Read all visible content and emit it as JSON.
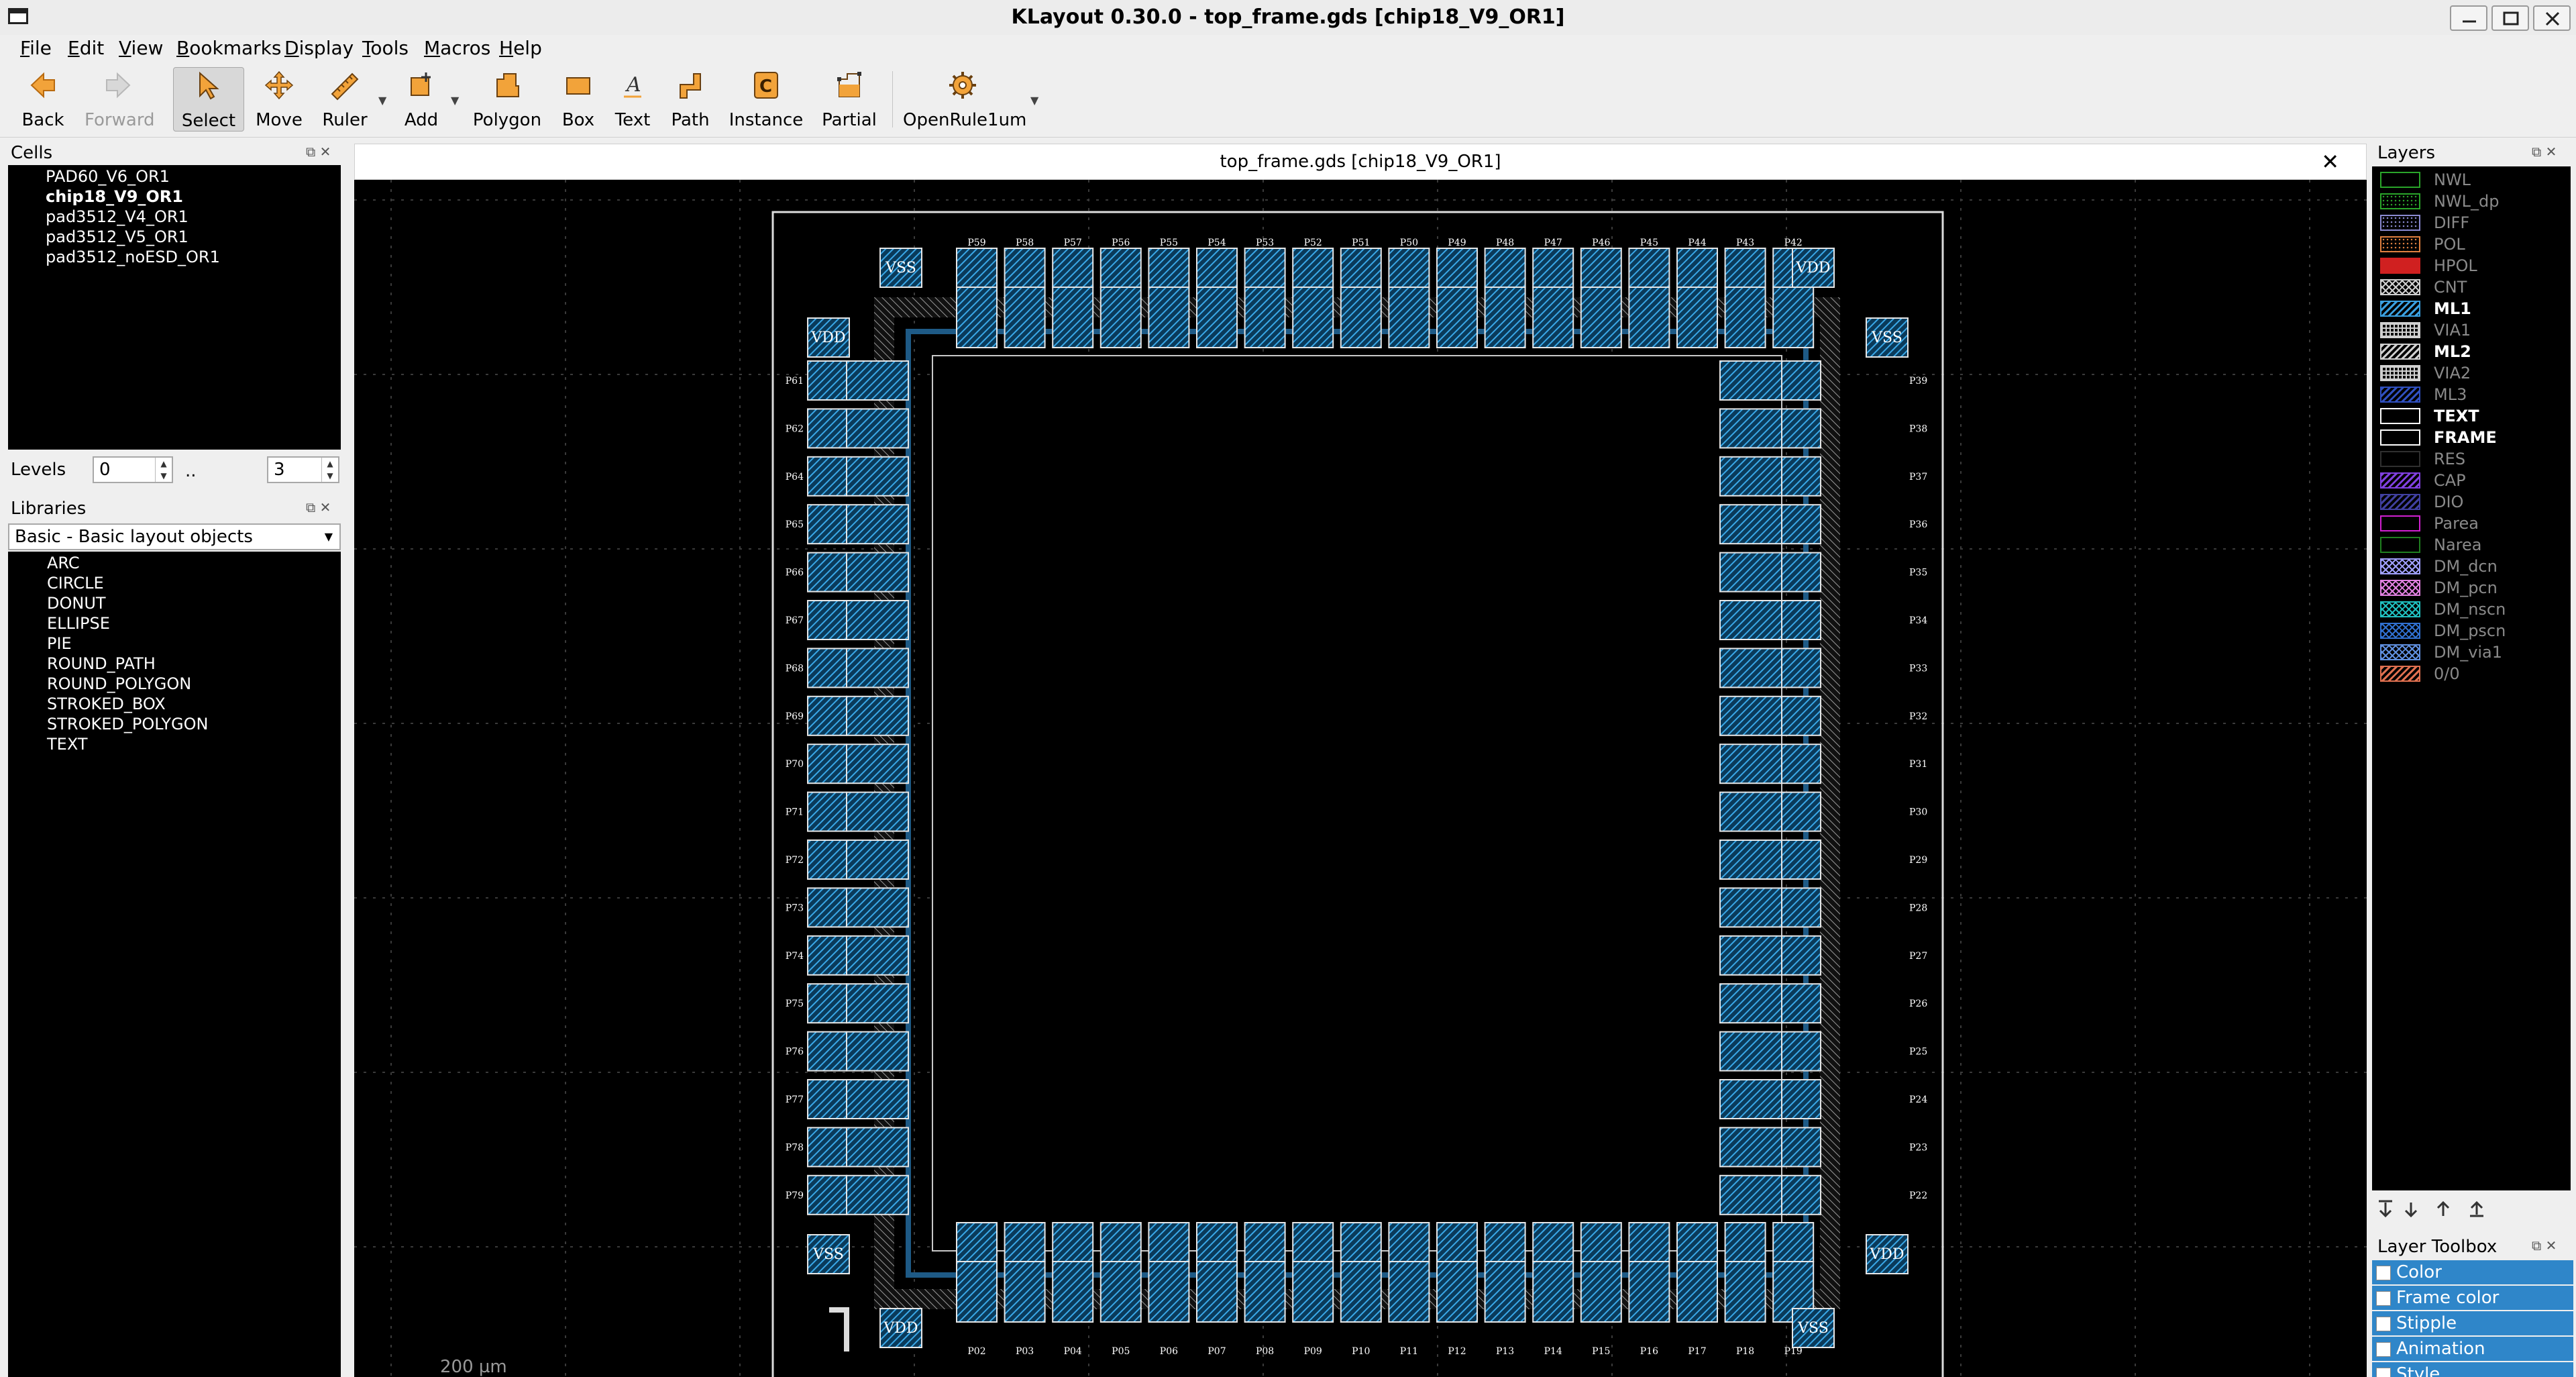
{
  "window": {
    "title": "KLayout 0.30.0 - top_frame.gds [chip18_V9_OR1]"
  },
  "menu": [
    {
      "pre": "",
      "u": "F",
      "post": "ile"
    },
    {
      "pre": "",
      "u": "E",
      "post": "dit"
    },
    {
      "pre": "",
      "u": "V",
      "post": "iew"
    },
    {
      "pre": "",
      "u": "B",
      "post": "ookmarks"
    },
    {
      "pre": "",
      "u": "D",
      "post": "isplay"
    },
    {
      "pre": "",
      "u": "T",
      "post": "ools"
    },
    {
      "pre": "",
      "u": "M",
      "post": "acros"
    },
    {
      "pre": "",
      "u": "H",
      "post": "elp"
    }
  ],
  "toolbar": {
    "back": "Back",
    "forward": "Forward",
    "select": "Select",
    "move": "Move",
    "ruler": "Ruler",
    "add": "Add",
    "polygon": "Polygon",
    "box": "Box",
    "text": "Text",
    "path": "Path",
    "instance": "Instance",
    "partial": "Partial",
    "macro": "OpenRule1um"
  },
  "cells": {
    "title": "Cells",
    "items": [
      "PAD60_V6_OR1",
      "chip18_V9_OR1",
      "pad3512_V4_OR1",
      "pad3512_V5_OR1",
      "pad3512_noESD_OR1"
    ],
    "selected": "chip18_V9_OR1"
  },
  "levels": {
    "label": "Levels",
    "from": "0",
    "sep": "..",
    "to": "3"
  },
  "libraries": {
    "title": "Libraries",
    "selected": "Basic - Basic layout objects",
    "items": [
      "ARC",
      "CIRCLE",
      "DONUT",
      "ELLIPSE",
      "PIE",
      "ROUND_PATH",
      "ROUND_POLYGON",
      "STROKED_BOX",
      "STROKED_POLYGON",
      "TEXT"
    ]
  },
  "view": {
    "tab_title": "top_frame.gds [chip18_V9_OR1]",
    "scale": "200 µm",
    "pads": {
      "top_left": "VSS",
      "top_right": "VDD",
      "side_left_upper": "VDD",
      "side_right_upper": "VSS",
      "side_left_lower": "VSS",
      "side_right_lower": "VDD",
      "bottom_left": "VDD",
      "bottom_right": "VSS",
      "top_labels": [
        "P59",
        "P58",
        "P57",
        "P56",
        "P55",
        "P54",
        "P53",
        "P52",
        "P51",
        "P50",
        "P49",
        "P48",
        "P47",
        "P46",
        "P45",
        "P44",
        "P43",
        "P42"
      ],
      "left_labels": [
        "P61",
        "P62",
        "P64",
        "P65",
        "P66",
        "P67",
        "P68",
        "P69",
        "P70",
        "P71",
        "P72",
        "P73",
        "P74",
        "P75",
        "P76",
        "P77",
        "P78",
        "P79"
      ],
      "right_labels": [
        "P39",
        "P38",
        "P37",
        "P36",
        "P35",
        "P34",
        "P33",
        "P32",
        "P31",
        "P30",
        "P29",
        "P28",
        "P27",
        "P26",
        "P25",
        "P24",
        "P23",
        "P22"
      ],
      "bottom_labels": [
        "P02",
        "P03",
        "P04",
        "P05",
        "P06",
        "P07",
        "P08",
        "P09",
        "P10",
        "P11",
        "P12",
        "P13",
        "P14",
        "P15",
        "P16",
        "P17",
        "P18",
        "P19"
      ]
    }
  },
  "layers": {
    "title": "Layers",
    "items": [
      {
        "name": "NWL",
        "color": "#2aa52a",
        "fill": "none",
        "dim": true
      },
      {
        "name": "NWL_dp",
        "color": "#2aa52a",
        "fill": "dots",
        "dim": true
      },
      {
        "name": "DIFF",
        "color": "#8a8ad0",
        "fill": "dots",
        "dim": true
      },
      {
        "name": "POL",
        "color": "#e08040",
        "fill": "dots",
        "dim": true
      },
      {
        "name": "HPOL",
        "color": "#d02020",
        "fill": "solid",
        "dim": true
      },
      {
        "name": "CNT",
        "color": "#d0d0d0",
        "fill": "cross",
        "dim": true
      },
      {
        "name": "ML1",
        "color": "#3aa0e0",
        "fill": "hatch",
        "dim": false
      },
      {
        "name": "VIA1",
        "color": "#d0d0d0",
        "fill": "grid",
        "dim": true
      },
      {
        "name": "ML2",
        "color": "#d0d0d0",
        "fill": "hatch",
        "dim": false
      },
      {
        "name": "VIA2",
        "color": "#d0d0d0",
        "fill": "grid",
        "dim": true
      },
      {
        "name": "ML3",
        "color": "#3050c0",
        "fill": "hatch",
        "dim": true
      },
      {
        "name": "TEXT",
        "color": "#ffffff",
        "fill": "none",
        "dim": false
      },
      {
        "name": "FRAME",
        "color": "#ffffff",
        "fill": "none",
        "dim": false
      },
      {
        "name": "RES",
        "color": "#303030",
        "fill": "none",
        "dim": true
      },
      {
        "name": "CAP",
        "color": "#8040e0",
        "fill": "hatch",
        "dim": true
      },
      {
        "name": "DIO",
        "color": "#4040a0",
        "fill": "hatch",
        "dim": true
      },
      {
        "name": "Parea",
        "color": "#d020d0",
        "fill": "none",
        "dim": true
      },
      {
        "name": "Narea",
        "color": "#208020",
        "fill": "none",
        "dim": true
      },
      {
        "name": "DM_dcn",
        "color": "#a0a0ff",
        "fill": "cross",
        "dim": true
      },
      {
        "name": "DM_pcn",
        "color": "#e080e0",
        "fill": "cross",
        "dim": true
      },
      {
        "name": "DM_nscn",
        "color": "#20c0c0",
        "fill": "cross",
        "dim": true
      },
      {
        "name": "DM_pscn",
        "color": "#3070d0",
        "fill": "cross",
        "dim": true
      },
      {
        "name": "DM_via1",
        "color": "#6090e0",
        "fill": "cross",
        "dim": true
      },
      {
        "name": "0/0",
        "color": "#e07050",
        "fill": "hatch",
        "dim": true
      }
    ]
  },
  "layer_toolbox": {
    "title": "Layer Toolbox",
    "items": [
      "Color",
      "Frame color",
      "Stipple",
      "Animation",
      "Style"
    ]
  }
}
